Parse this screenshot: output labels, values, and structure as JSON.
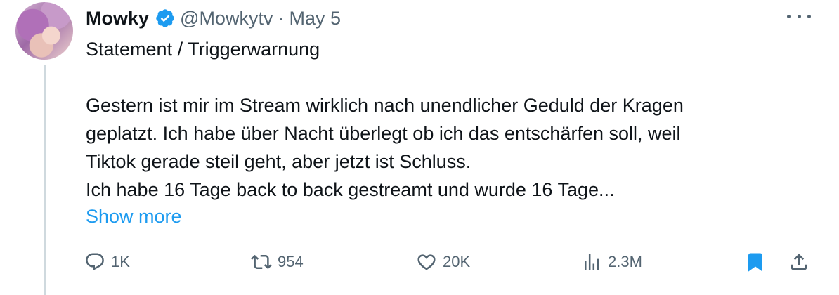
{
  "author": {
    "name": "Mowky",
    "handle": "@Mowkytv",
    "separator": "·",
    "date": "May 5"
  },
  "tweet": {
    "lines": [
      "Statement / Triggerwarnung",
      "",
      "Gestern ist mir im Stream wirklich nach unendlicher Geduld der Kragen",
      "geplatzt. Ich habe über Nacht überlegt ob ich das entschärfen soll, weil",
      "Tiktok gerade steil geht, aber jetzt ist Schluss.",
      "Ich habe 16 Tage back to back gestreamt und wurde 16 Tage..."
    ],
    "show_more": "Show more"
  },
  "actions": {
    "reply_count": "1K",
    "retweet_count": "954",
    "like_count": "20K",
    "view_count": "2.3M"
  },
  "colors": {
    "link": "#1d9bf0",
    "muted": "#536471",
    "text": "#0f1419",
    "thread_line": "#cfd9de",
    "bookmark_active": "#1d9bf0"
  },
  "icons": [
    "verified-badge-icon",
    "more-icon",
    "reply-icon",
    "retweet-icon",
    "like-icon",
    "views-icon",
    "bookmark-icon",
    "share-icon"
  ]
}
